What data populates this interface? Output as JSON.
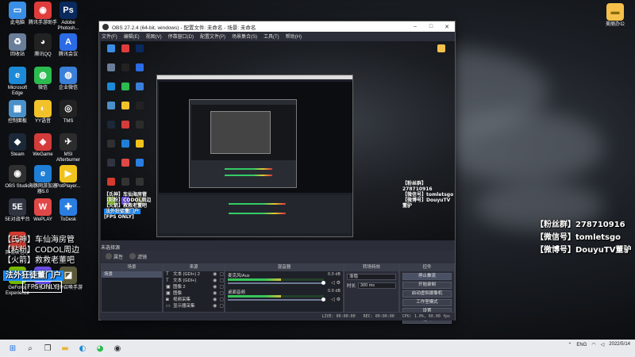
{
  "desktop": {
    "left_icons": [
      {
        "label": "此电脑",
        "icon": "computer-icon",
        "color": "#3a8ee6"
      },
      {
        "label": "腾讯手游助手",
        "icon": "game-assistant-icon",
        "color": "#e03c3c"
      },
      {
        "label": "Adobe Photosh...",
        "icon": "photoshop-icon",
        "color": "#0a2a5e"
      },
      {
        "label": "回收站",
        "icon": "recycle-bin-icon",
        "color": "#6a7e9a"
      },
      {
        "label": "腾讯QQ",
        "icon": "qq-icon",
        "color": "#222222"
      },
      {
        "label": "腾讯会议",
        "icon": "tencent-meeting-icon",
        "color": "#2b6be6"
      },
      {
        "label": "Microsoft Edge",
        "icon": "edge-icon",
        "color": "#1b8ad8"
      },
      {
        "label": "微信",
        "icon": "wechat-icon",
        "color": "#2bbb4f"
      },
      {
        "label": "企业微信",
        "icon": "wecom-icon",
        "color": "#3a7fd9"
      },
      {
        "label": "控制面板",
        "icon": "control-panel-icon",
        "color": "#4a90c9"
      },
      {
        "label": "YY语音",
        "icon": "yy-icon",
        "color": "#f2c22a"
      },
      {
        "label": "TMS",
        "icon": "tms-icon",
        "color": "#222222"
      },
      {
        "label": "Steam",
        "icon": "steam-icon",
        "color": "#1b2838"
      },
      {
        "label": "WeGame",
        "icon": "wegame-icon",
        "color": "#d43b3b"
      },
      {
        "label": "MSI Afterburner",
        "icon": "afterburner-icon",
        "color": "#2c2c2c"
      },
      {
        "label": "OBS Studio",
        "icon": "obs-icon",
        "color": "#303030"
      },
      {
        "label": "海豚网游加速器5.0",
        "icon": "dolphin-accelerator-icon",
        "color": "#1f7fd6"
      },
      {
        "label": "PotPlayer...",
        "icon": "potplayer-icon",
        "color": "#f0c21c"
      },
      {
        "label": "5E对战平台",
        "icon": "5e-platform-icon",
        "color": "#2f3440"
      },
      {
        "label": "WePLAY",
        "icon": "weplay-icon",
        "color": "#e04848"
      },
      {
        "label": "ToDesk",
        "icon": "todesk-icon",
        "color": "#2a7de1"
      },
      {
        "label": "网易云音乐",
        "icon": "netease-music-icon",
        "color": "#d53a2e"
      },
      {
        "label": "",
        "icon": "app-icon",
        "color": "#333333"
      },
      {
        "label": "",
        "icon": "app-icon-2",
        "color": "#333333"
      },
      {
        "label": "GeForce Experience",
        "icon": "geforce-icon",
        "color": "#76b900"
      },
      {
        "label": "阿里云盘",
        "icon": "aliyun-drive-icon",
        "color": "#6b4ce6"
      },
      {
        "label": "使命召唤手游",
        "icon": "codm-icon",
        "color": "#5a5a3a"
      }
    ],
    "right_icon": {
      "label": "美丽办公",
      "icon": "folder-icon",
      "color": "#f5c14a"
    }
  },
  "overlays": {
    "right_lines": [
      "【粉丝群】278710916",
      "【微信号】tomletsgo",
      "【微博号】DouyuTV董驴"
    ],
    "left_lines": [
      "【氏神】车仙海房管",
      "【粘粉】CODOL周边",
      "【火箭】救救老董吧"
    ],
    "left_ribbon": "法外狂徒董门户",
    "left_fps": "[FPS ONLY]"
  },
  "obs": {
    "title": "OBS 27.2.4 (64-bit, windows) - 配置文件: 未命名 - 场景: 未命名",
    "menu": [
      "文件(F)",
      "编辑(E)",
      "视图(V)",
      "停靠窗口(D)",
      "配置文件(P)",
      "场景集合(S)",
      "工具(T)",
      "帮助(H)"
    ],
    "scene_status": "未选择源",
    "toolbar": {
      "properties": "属性",
      "filters": "滤镜"
    },
    "docks": {
      "scenes": {
        "title": "场景",
        "items": [
          "场景"
        ]
      },
      "sources": {
        "title": "来源",
        "items": [
          {
            "label": "文本 (GDI+) 2",
            "icon": "text-icon"
          },
          {
            "label": "文本 (GDI+)",
            "icon": "text-icon"
          },
          {
            "label": "图像 2",
            "icon": "image-icon"
          },
          {
            "label": "图像",
            "icon": "image-icon"
          },
          {
            "label": "视频采集",
            "icon": "camera-icon"
          },
          {
            "label": "显示器采集",
            "icon": "monitor-icon"
          }
        ]
      },
      "mixer": {
        "title": "混音器",
        "channels": [
          {
            "name": "麦克风/Aux",
            "db": "0.0 dB",
            "level": 0.55
          },
          {
            "name": "桌面音频",
            "db": "0.0 dB",
            "level": 0.55
          }
        ]
      },
      "transitions": {
        "title": "转场特效",
        "type": "渐隐",
        "duration_label": "时长",
        "duration": "300 ms"
      },
      "controls": {
        "title": "控件",
        "buttons": [
          "停止推流",
          "开始录制",
          "启动虚拟摄像机",
          "工作室模式",
          "设置",
          "退出"
        ]
      }
    },
    "status": {
      "live": "LIVE: 00:00:00",
      "rec": "REC: 00:00:00",
      "cpu": "CPU: 1.0%, 60.00 fps"
    }
  },
  "taskbar": {
    "items": [
      "start-icon",
      "search-icon",
      "task-view-icon",
      "folder-taskbar-icon",
      "edge-taskbar-icon",
      "wechat-taskbar-icon",
      "obs-taskbar-icon"
    ],
    "tray": {
      "lang": "ENG",
      "time": "",
      "date": "2022/5/14"
    }
  }
}
